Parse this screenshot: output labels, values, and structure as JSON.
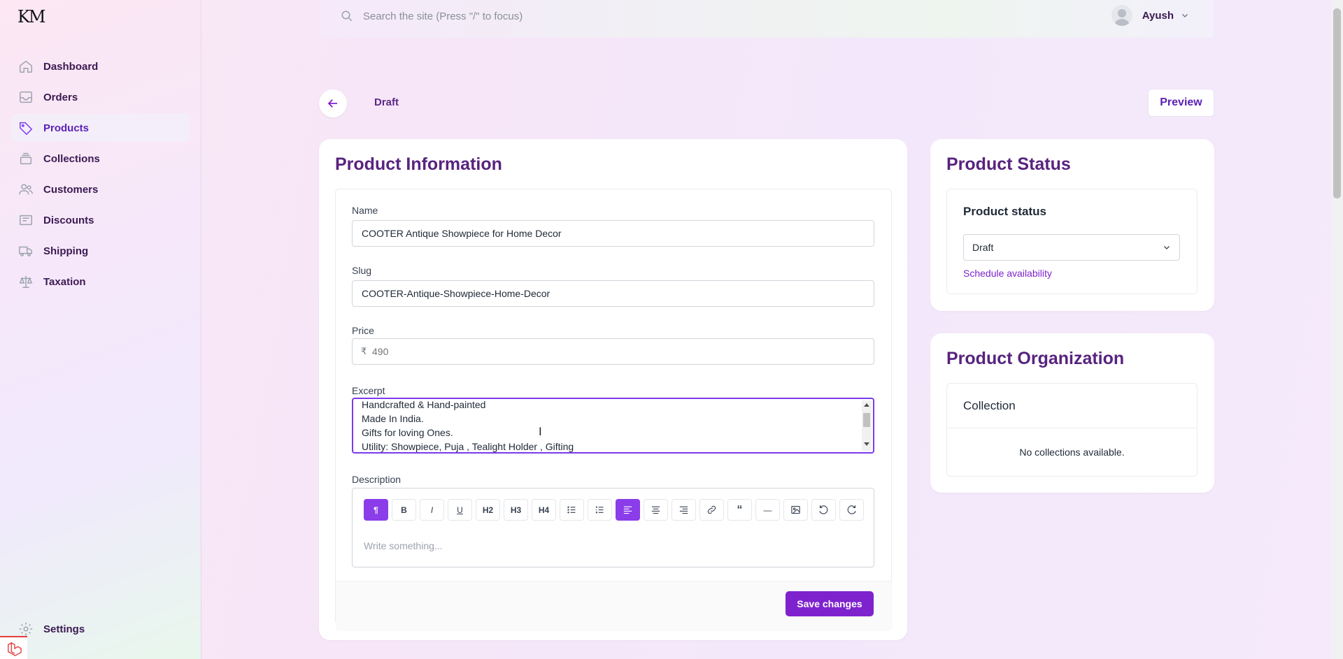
{
  "brand": {
    "logo_text": "KM"
  },
  "sidebar": {
    "items": [
      {
        "label": "Dashboard",
        "icon": "home-icon"
      },
      {
        "label": "Orders",
        "icon": "inbox-icon"
      },
      {
        "label": "Products",
        "icon": "tag-icon",
        "active": true
      },
      {
        "label": "Collections",
        "icon": "stack-icon"
      },
      {
        "label": "Customers",
        "icon": "users-icon"
      },
      {
        "label": "Discounts",
        "icon": "receipt-icon"
      },
      {
        "label": "Shipping",
        "icon": "truck-icon"
      },
      {
        "label": "Taxation",
        "icon": "scale-icon"
      }
    ],
    "settings_label": "Settings"
  },
  "topbar": {
    "search_placeholder": "Search the site (Press \"/\" to focus)",
    "username": "Ayush"
  },
  "page": {
    "status_label": "Draft",
    "preview_label": "Preview"
  },
  "product_info": {
    "title": "Product Information",
    "name_label": "Name",
    "name_value": "COOTER Antique Showpiece for Home Decor",
    "slug_label": "Slug",
    "slug_value": "COOTER-Antique-Showpiece-Home-Decor",
    "price_label": "Price",
    "currency_symbol": "₹",
    "price_placeholder": "490",
    "excerpt_label": "Excerpt",
    "excerpt_lines": [
      "Handcrafted & Hand-painted",
      "Made In India.",
      "Gifts for loving Ones.",
      "Utility: Showpiece, Puja , Tealight Holder , Gifting"
    ],
    "description_label": "Description",
    "editor_placeholder": "Write something...",
    "toolbar": [
      {
        "name": "paragraph",
        "label": "¶",
        "active": true
      },
      {
        "name": "bold",
        "label": "B"
      },
      {
        "name": "italic",
        "label": "I"
      },
      {
        "name": "underline",
        "label": "U"
      },
      {
        "name": "heading-2",
        "label": "H2"
      },
      {
        "name": "heading-3",
        "label": "H3"
      },
      {
        "name": "heading-4",
        "label": "H4"
      },
      {
        "name": "bullet-list",
        "label": ""
      },
      {
        "name": "ordered-list",
        "label": ""
      },
      {
        "name": "align-left",
        "label": "",
        "active": true
      },
      {
        "name": "align-center",
        "label": ""
      },
      {
        "name": "align-right",
        "label": ""
      },
      {
        "name": "link",
        "label": ""
      },
      {
        "name": "blockquote",
        "label": "“"
      },
      {
        "name": "horizontal-rule",
        "label": "—"
      },
      {
        "name": "image",
        "label": ""
      },
      {
        "name": "undo",
        "label": ""
      },
      {
        "name": "redo",
        "label": ""
      }
    ],
    "save_label": "Save changes"
  },
  "product_status": {
    "title": "Product Status",
    "subtitle": "Product status",
    "selected": "Draft",
    "schedule_label": "Schedule availability"
  },
  "product_org": {
    "title": "Product Organization",
    "collection_label": "Collection",
    "empty_text": "No collections available."
  },
  "colors": {
    "accent": "#7e22ce",
    "heading": "#58237f"
  }
}
